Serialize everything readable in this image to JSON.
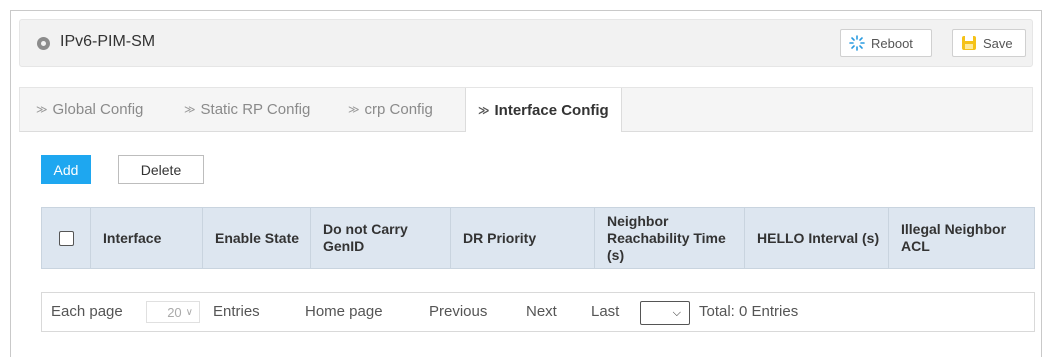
{
  "header": {
    "title": "IPv6-PIM-SM",
    "reboot_label": "Reboot",
    "save_label": "Save"
  },
  "tabs": [
    {
      "label": "Global Config",
      "active": false
    },
    {
      "label": "Static RP Config",
      "active": false
    },
    {
      "label": "crp Config",
      "active": false
    },
    {
      "label": "Interface Config",
      "active": true
    }
  ],
  "actions": {
    "add_label": "Add",
    "delete_label": "Delete"
  },
  "table": {
    "columns": [
      "Interface",
      "Enable State",
      "Do not Carry GenID",
      "DR Priority",
      "Neighbor Reachability Time (s)",
      "HELLO Interval (s)",
      "Illegal Neighbor ACL"
    ],
    "rows": []
  },
  "pager": {
    "each_page_label": "Each page",
    "page_size": "20",
    "entries_label": "Entries",
    "home_label": "Home page",
    "previous_label": "Previous",
    "next_label": "Next",
    "last_label": "Last",
    "page_select_value": "",
    "total_label": "Total: 0 Entries"
  },
  "colors": {
    "accent": "#1ea7f0",
    "header_bg": "#dde6f0"
  },
  "icons": {
    "header": "circle-icon",
    "reboot": "reboot-icon",
    "save": "save-icon",
    "tab_chevron": "chevron-right-icon"
  }
}
